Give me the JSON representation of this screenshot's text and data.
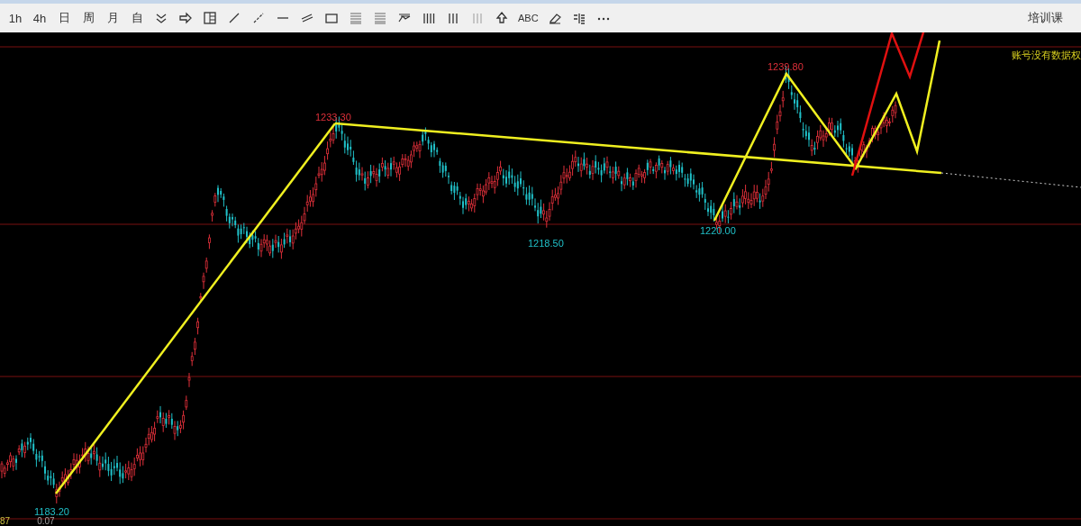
{
  "toolbar": {
    "timeframes": [
      "1h",
      "4h",
      "日",
      "周",
      "月",
      "自"
    ],
    "text_tool": "ABC",
    "course_button": "培训课"
  },
  "chart": {
    "notice": "账号没有数据权",
    "price_labels": [
      {
        "text": "1233.30",
        "color": "#e0303a"
      },
      {
        "text": "1239.80",
        "color": "#e0303a"
      },
      {
        "text": "1218.50",
        "color": "#20c0c8"
      },
      {
        "text": "1220.00",
        "color": "#20c0c8"
      },
      {
        "text": "1183.20",
        "color": "#20c0c8"
      }
    ],
    "bottom_values": [
      {
        "text": "87"
      },
      {
        "text": "0.07"
      }
    ]
  }
}
